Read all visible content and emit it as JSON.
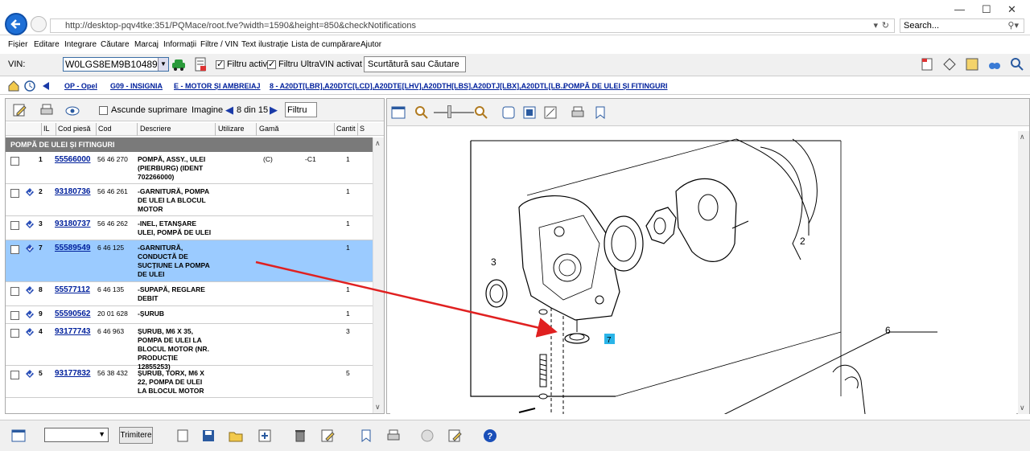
{
  "browser": {
    "url": "http://desktop-pqv4tke:351/PQMace/root.fve?width=1590&height=850&checkNotifications",
    "search_placeholder": "Search..."
  },
  "menu": [
    "Fișier",
    "Editare",
    "Integrare",
    "Căutare",
    "Marcaj",
    "Informații",
    "Filtre / VIN",
    "Text ilustrație",
    "Lista de cumpărare",
    "Ajutor"
  ],
  "toolbar": {
    "vin_label": "VIN:",
    "vin_value": "W0LGS8EM9B1048952",
    "filter_active": "Filtru activ",
    "filter_ultravin": "Filtru UltraVIN activat",
    "shortcut_placeholder": "Scurtătură sau Căutare"
  },
  "breadcrumb": [
    "OP - Opel",
    "G09 - INSIGNIA",
    "E - MOTOR ȘI AMBREIAJ",
    "8 - A20DT[LBR],A20DTC[LCD],A20DTE[LHV],A20DTH[LBS],A20DTJ[LBX],A20DTL[LB...",
    "POMPĂ DE ULEI ȘI FITINGURI"
  ],
  "left": {
    "hide_deletion": "Ascunde suprimare",
    "image_label": "Imagine",
    "image_counter": "8 din 15",
    "filter_btn": "Filtru",
    "columns": [
      "IL",
      "Cod piesă",
      "Cod",
      "Descriere",
      "Utilizare",
      "Gamă",
      "Cantit",
      "S"
    ],
    "group_title": "POMPĂ DE ULEI ȘI FITINGURI",
    "rows": [
      {
        "il": "1",
        "code": "55566000",
        "cod": "56 46 270",
        "desc": "POMPĂ, ASSY., ULEI (PIERBURG) (IDENT 702266000)",
        "gama": "(C)",
        "extra": "-C1",
        "qty": "1"
      },
      {
        "il": "2",
        "code": "93180736",
        "cod": "56 46 261",
        "desc": "-GARNITURĂ, POMPA DE ULEI LA BLOCUL MOTOR",
        "gama": "",
        "extra": "",
        "qty": "1"
      },
      {
        "il": "3",
        "code": "93180737",
        "cod": "56 46 262",
        "desc": "-INEL, ETANȘARE ULEI, POMPĂ DE ULEI",
        "gama": "",
        "extra": "",
        "qty": "1"
      },
      {
        "il": "7",
        "code": "55589549",
        "cod": "6 46 125",
        "desc": "-GARNITURĂ, CONDUCTĂ DE SUCȚIUNE LA POMPA DE ULEI",
        "gama": "",
        "extra": "",
        "qty": "1"
      },
      {
        "il": "8",
        "code": "55577112",
        "cod": "6 46 135",
        "desc": "-SUPAPĂ, REGLARE DEBIT",
        "gama": "",
        "extra": "",
        "qty": "1"
      },
      {
        "il": "9",
        "code": "55590562",
        "cod": "20 01 628",
        "desc": "-ȘURUB",
        "gama": "",
        "extra": "",
        "qty": "1"
      },
      {
        "il": "4",
        "code": "93177743",
        "cod": "6 46 963",
        "desc": "ȘURUB, M6 X 35, POMPA DE ULEI LA BLOCUL MOTOR (NR. PRODUCȚIE 12855253)",
        "gama": "",
        "extra": "",
        "qty": "3"
      },
      {
        "il": "5",
        "code": "93177832",
        "cod": "56 38 432",
        "desc": "ȘURUB, TORX, M6 X 22, POMPA DE ULEI LA BLOCUL MOTOR",
        "gama": "",
        "extra": "",
        "qty": "5"
      }
    ]
  },
  "diagram": {
    "callouts": [
      "2",
      "3",
      "6",
      "7"
    ]
  },
  "bottom": {
    "send": "Trimitere"
  }
}
